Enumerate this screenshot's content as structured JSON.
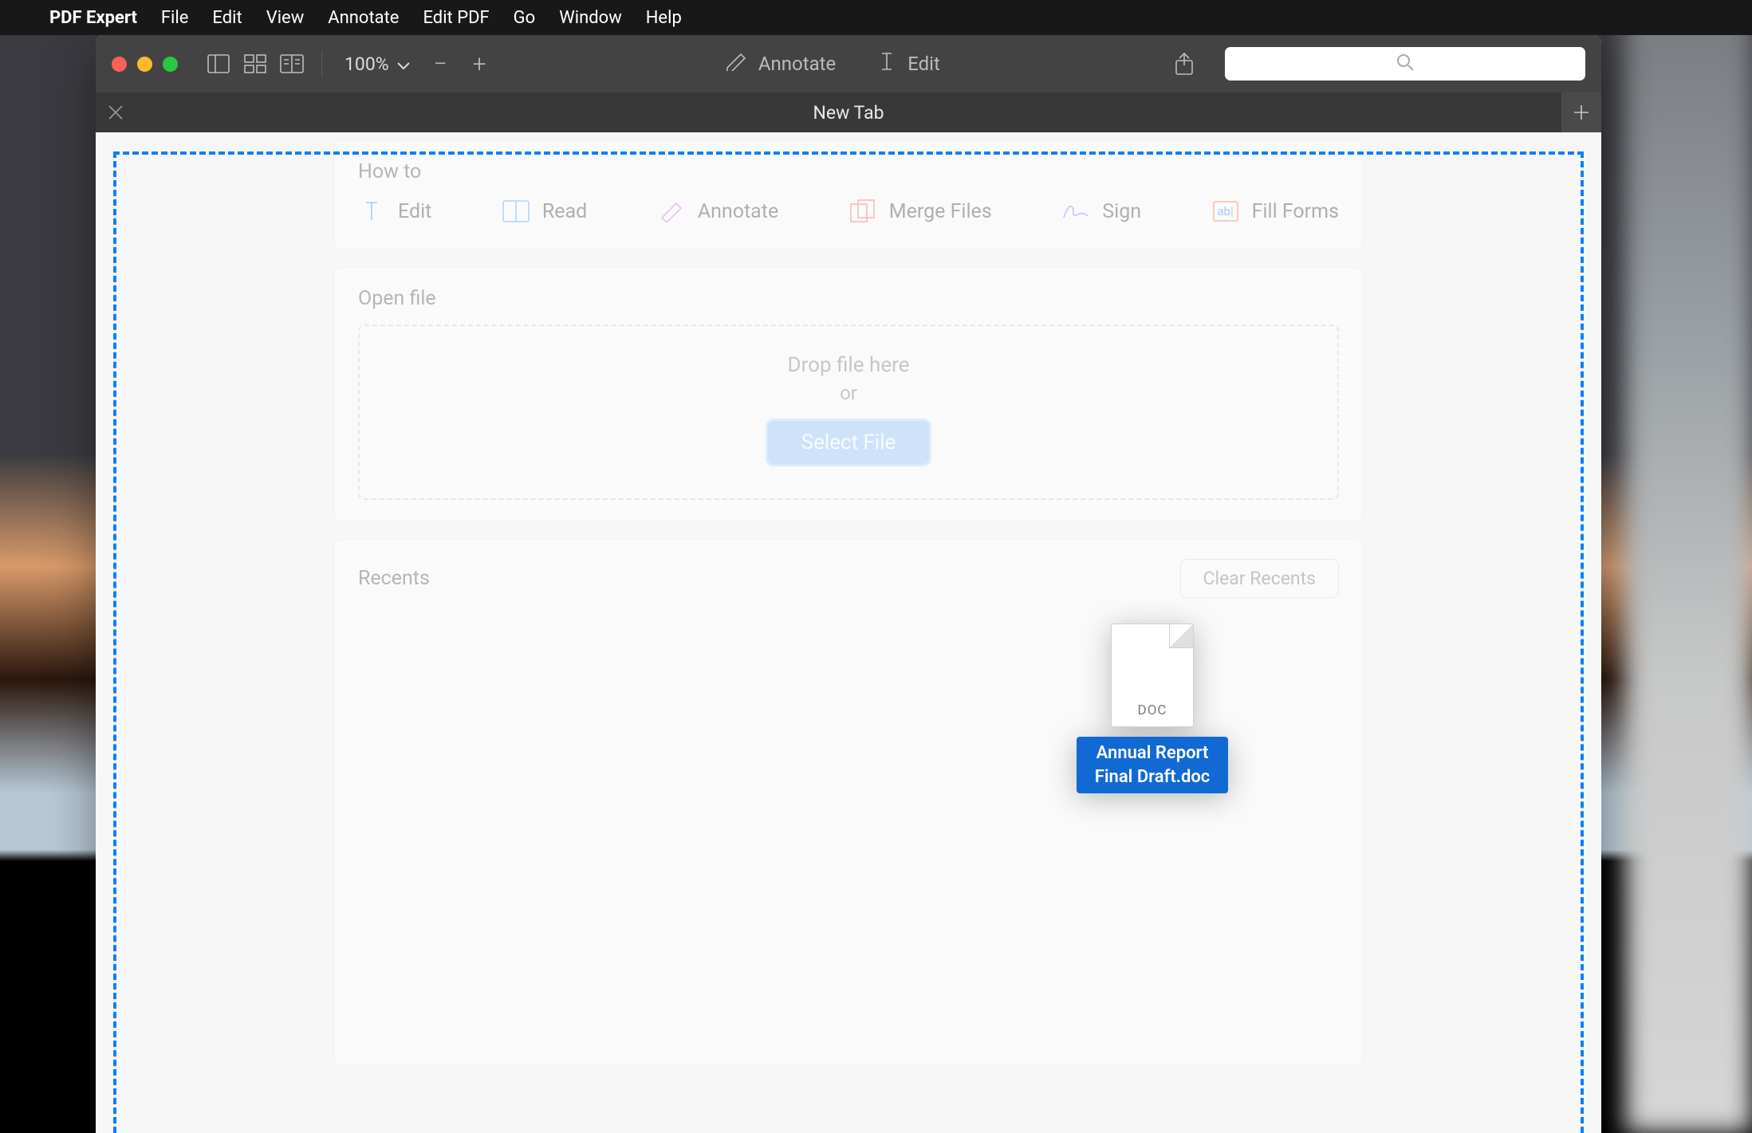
{
  "menubar": {
    "app": "PDF Expert",
    "items": [
      "File",
      "Edit",
      "View",
      "Annotate",
      "Edit PDF",
      "Go",
      "Window",
      "Help"
    ]
  },
  "toolbar": {
    "zoom": "100%",
    "annotate": "Annotate",
    "edit": "Edit"
  },
  "tab": {
    "title": "New Tab"
  },
  "howto": {
    "heading": "How to",
    "items": [
      "Edit",
      "Read",
      "Annotate",
      "Merge Files",
      "Sign",
      "Fill Forms"
    ]
  },
  "openfile": {
    "heading": "Open file",
    "drop": "Drop file here",
    "or": "or",
    "select": "Select File"
  },
  "recents": {
    "heading": "Recents",
    "clear": "Clear Recents"
  },
  "drag": {
    "ext": "DOC",
    "filename": "Annual Report Final Draft.doc"
  },
  "fillbox": "ab"
}
